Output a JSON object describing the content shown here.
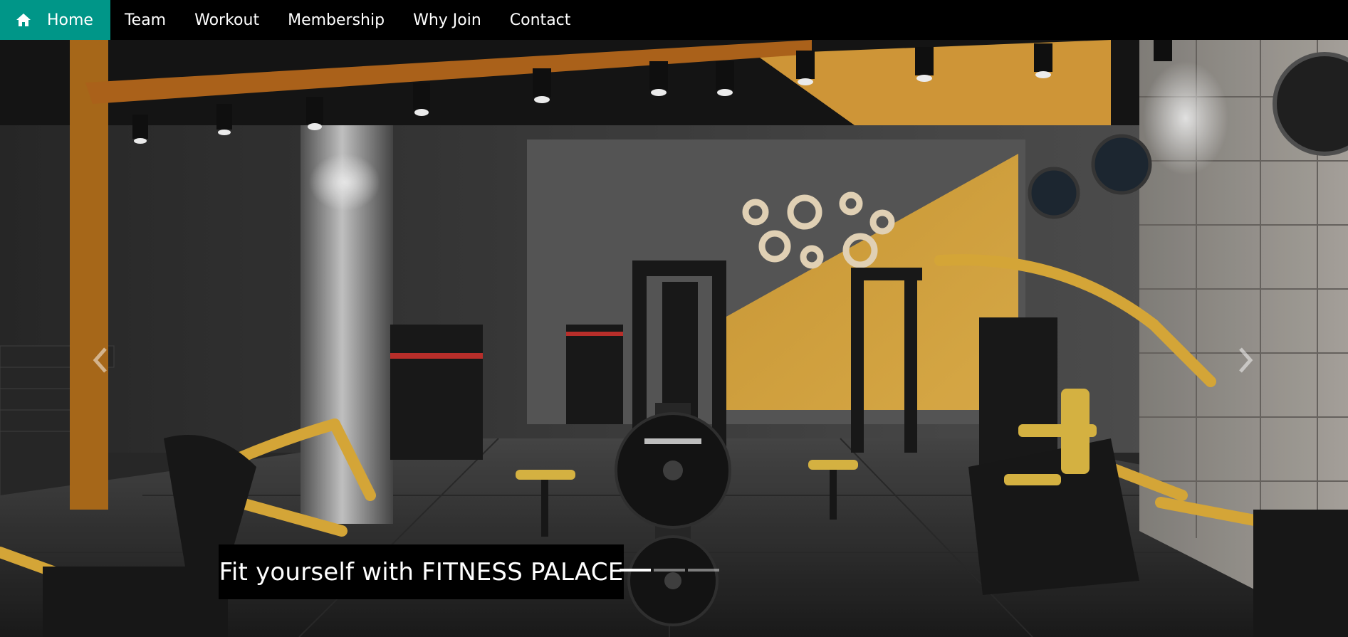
{
  "nav": {
    "items": [
      {
        "label": "Home",
        "icon": "home-icon",
        "active": true
      },
      {
        "label": "Team"
      },
      {
        "label": "Workout"
      },
      {
        "label": "Membership"
      },
      {
        "label": "Why Join"
      },
      {
        "label": "Contact"
      }
    ],
    "active_color": "#009688"
  },
  "hero": {
    "caption": "Fit yourself with FITNESS PALACE",
    "slides_count": 3,
    "active_slide": 1,
    "prev_icon": "chevron-left-icon",
    "next_icon": "chevron-right-icon"
  }
}
